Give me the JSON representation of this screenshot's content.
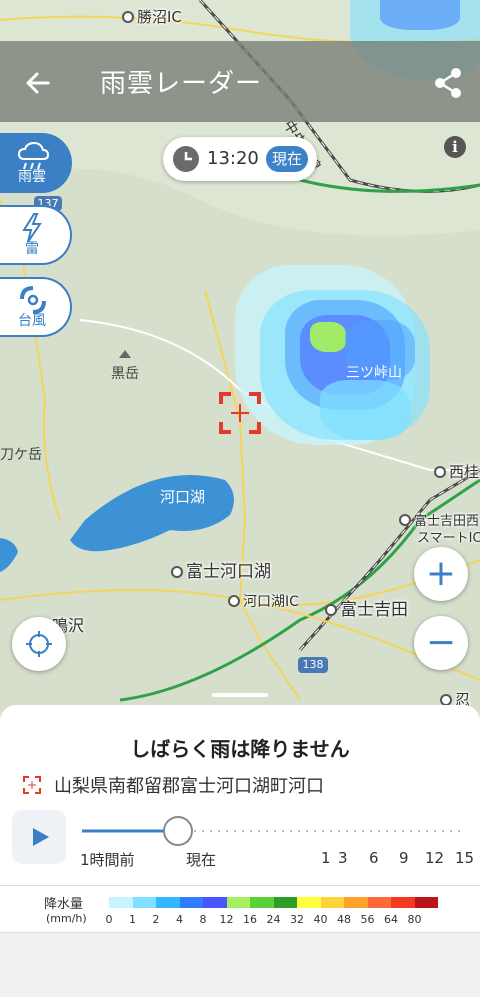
{
  "header": {
    "title": "雨雲レーダー",
    "back_icon": "arrow-left-icon",
    "share_icon": "share-icon"
  },
  "time_pill": {
    "time": "13:20",
    "now_label": "現在",
    "clock_icon": "clock-icon"
  },
  "info_icon": "info-icon",
  "layers": [
    {
      "label": "雨雲",
      "icon": "rain-cloud-icon",
      "active": true
    },
    {
      "label": "雷",
      "icon": "lightning-icon",
      "active": false
    },
    {
      "label": "台風",
      "icon": "typhoon-icon",
      "active": false
    }
  ],
  "map_labels": {
    "ic_top": "勝沼IC",
    "rail": "中央本線",
    "route_137": "137",
    "kurodake": "黒岳",
    "mitsutoge": "三ツ峠山",
    "kintoki": "刀ケ岳",
    "lake": "河口湖",
    "nishi": "西桂",
    "fujiyoshida_smart": "富士吉田西",
    "fujiyoshida_smart2": "スマートIC",
    "fujikawaguchiko": "富士河口湖",
    "kawaguchiko_ic": "河口湖IC",
    "fujiyoshida": "富士吉田",
    "narusawa": "鳴沢",
    "route_138": "138",
    "oshino": "忍"
  },
  "controls": {
    "zoom_in": "+",
    "zoom_out": "−",
    "locate_icon": "crosshair-icon"
  },
  "forecast": {
    "headline": "しばらく雨は降りません",
    "location": "山梨県南都留郡富士河口湖町河口",
    "play_icon": "play-icon",
    "slider_position": 0.25,
    "ticks": [
      "1時間前",
      "現在",
      "1",
      "3",
      "6",
      "9",
      "12",
      "15"
    ]
  },
  "legend": {
    "title": "降水量",
    "unit": "(mm/h)",
    "levels": [
      "0",
      "1",
      "2",
      "4",
      "8",
      "12",
      "16",
      "24",
      "32",
      "40",
      "48",
      "56",
      "64",
      "80"
    ],
    "colors": [
      "#c8f4ff",
      "#7fe0ff",
      "#33b8ff",
      "#2f7cff",
      "#4a55ff",
      "#a4f060",
      "#5ad136",
      "#2f9d2a",
      "#ffff3c",
      "#ffd23a",
      "#ffa22c",
      "#ff6a3a",
      "#f43a1f",
      "#b9151a"
    ]
  }
}
